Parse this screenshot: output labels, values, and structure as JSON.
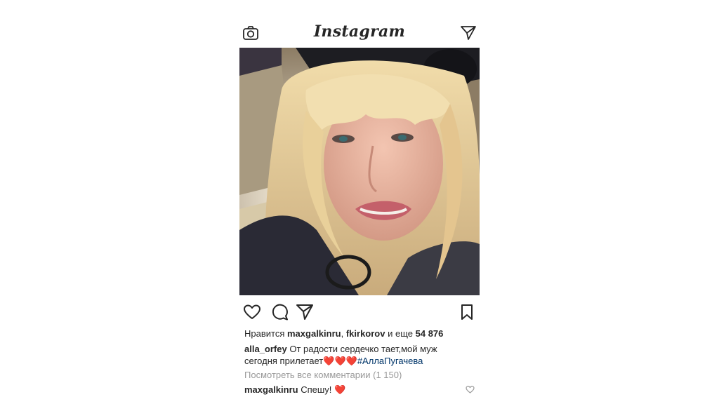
{
  "header": {
    "logo_text": "Instagram",
    "left_icon": "camera-icon",
    "right_icon": "direct-message-icon"
  },
  "post": {
    "image_icon": "post-photo",
    "actions": {
      "like_icon": "heart-outline-icon",
      "comment_icon": "comment-icon",
      "share_icon": "paper-plane-icon",
      "save_icon": "bookmark-icon"
    },
    "likes": {
      "prefix": "Нравится",
      "user1": "maxgalkinru",
      "separator": ",",
      "user2": "fkirkorov",
      "conj": "и еще",
      "count": "54 876"
    },
    "caption": {
      "author": "alla_orfey",
      "text": "От радости сердечко тает,мой муж сегодня прилетает",
      "hearts": "❤️❤️❤️",
      "hashtag": "#АллаПугачева"
    },
    "view_all_comments": "Посмотреть все комментарии (1 150)",
    "comment": {
      "author": "maxgalkinru",
      "text": "Спешу!",
      "heart": "❤️"
    },
    "colors": {
      "text": "#262626",
      "muted": "#999999",
      "hashtag": "#003569",
      "heart": "#e0162b"
    }
  }
}
